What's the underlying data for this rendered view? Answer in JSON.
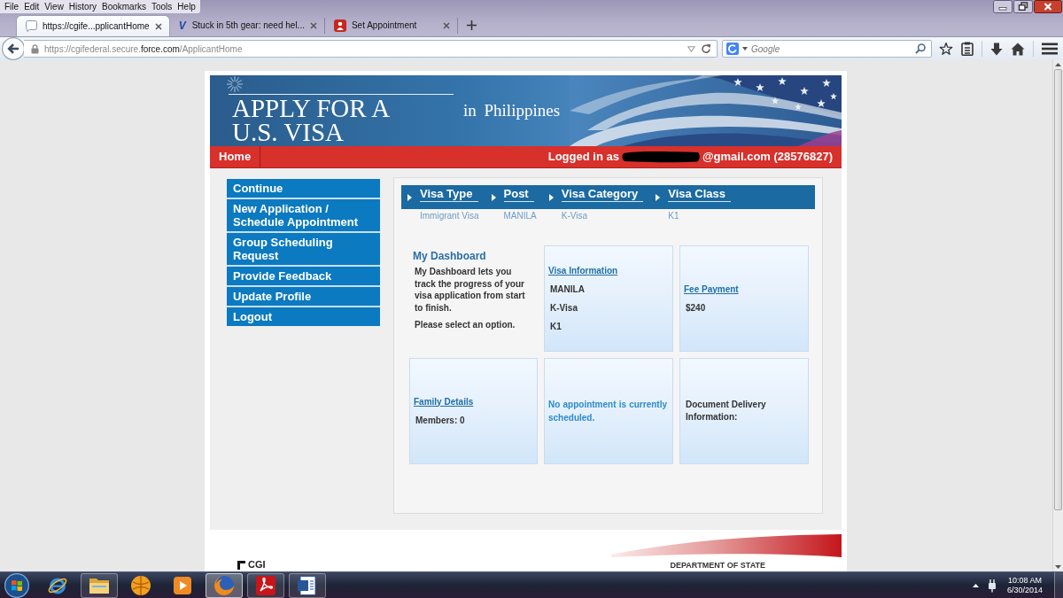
{
  "browser": {
    "menu": [
      "File",
      "Edit",
      "View",
      "History",
      "Bookmarks",
      "Tools",
      "Help"
    ],
    "tabs": [
      {
        "kind": "page",
        "title": "https://cgife...pplicantHome",
        "selected": true
      },
      {
        "kind": "letter",
        "icon_text": "V",
        "title": "Stuck in 5th gear: need hel...",
        "selected": false
      },
      {
        "kind": "badge",
        "title": "Set Appointment",
        "selected": false
      }
    ],
    "address": {
      "secure": true,
      "prefix": "https://cgifederal.secure.",
      "domain": "force.com",
      "path": "/ApplicantHome"
    },
    "search": {
      "placeholder": "Google"
    }
  },
  "site": {
    "banner": {
      "title": "APPLY FOR A U.S. VISA",
      "location": "in Philippines"
    },
    "topbar": {
      "home": "Home",
      "login_label": "Logged in as",
      "email_hidden": true,
      "login_detail": "@gmail.com (28576827)"
    },
    "sidebar": {
      "items": [
        "Continue",
        "New Application / Schedule Appointment",
        "Group Scheduling Request",
        "Provide Feedback",
        "Update Profile",
        "Logout"
      ]
    },
    "steps": [
      {
        "label": "Visa Type",
        "value": "Immigrant Visa"
      },
      {
        "label": "Post",
        "value": "MANILA"
      },
      {
        "label": "Visa Category",
        "value": "K-Visa"
      },
      {
        "label": "Visa Class",
        "value": "K1"
      }
    ],
    "dashboard": {
      "title": "My Dashboard",
      "description": "My Dashboard lets you track the progress of your visa application from start to finish.",
      "prompt": "Please select an option."
    },
    "cards": [
      {
        "kind": "details",
        "link": "Visa Information",
        "lines": [
          "MANILA",
          "K-Visa",
          "K1"
        ]
      },
      {
        "kind": "details",
        "link": "Fee Payment",
        "lines": [
          "$240"
        ]
      },
      {
        "kind": "details",
        "link": "Family Details",
        "lines": [
          "Members: 0"
        ]
      },
      {
        "kind": "notice",
        "text": "No appointment is currently scheduled."
      },
      {
        "kind": "note",
        "text": "Document Delivery Information:"
      }
    ],
    "footer": {
      "logo": "CGI",
      "department": "DEPARTMENT OF STATE"
    }
  },
  "taskbar": {
    "apps": [
      {
        "kind": "orbit",
        "running": false,
        "selected": false
      },
      {
        "kind": "folder",
        "running": true,
        "selected": false
      },
      {
        "kind": "ball",
        "running": false,
        "selected": false
      },
      {
        "kind": "play",
        "running": false,
        "selected": false
      },
      {
        "kind": "globe",
        "running": true,
        "selected": true
      },
      {
        "kind": "ribbon",
        "running": true,
        "selected": false
      },
      {
        "kind": "document",
        "running": true,
        "selected": false
      }
    ],
    "time": "10:08 AM",
    "date": "6/30/2014"
  }
}
